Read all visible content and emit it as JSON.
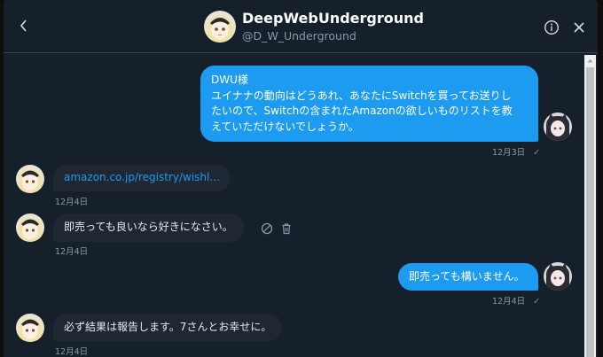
{
  "header": {
    "name": "DeepWebUnderground",
    "handle": "@D_W_Underground",
    "back_icon": "chevron-left-icon",
    "info_icon": "info-icon",
    "close_icon": "close-icon"
  },
  "colors": {
    "background": "#15202b",
    "outgoing_bubble": "#1d9bf0",
    "incoming_bubble": "#1e2732",
    "link": "#1d9bf0",
    "muted": "#8b98a5"
  },
  "messages": [
    {
      "direction": "outgoing",
      "lines": [
        "DWU様",
        "ユイナナの動向はどうあれ、あなたにSwitchを買ってお送りし",
        "たいので、Switchの含まれたAmazonの欲しいものリストを教",
        "えていただけないでしょうか。"
      ],
      "time": "12月3日",
      "status": "✓"
    },
    {
      "direction": "incoming",
      "link": "amazon.co.jp/registry/wishl…",
      "time": "12月4日"
    },
    {
      "direction": "incoming",
      "text": "即売っても良いなら好きになさい。",
      "time": "12月4日",
      "actions": [
        "report-icon",
        "trash-icon"
      ]
    },
    {
      "direction": "outgoing",
      "text": "即売っても構いません。",
      "time": "12月4日",
      "status": "✓"
    },
    {
      "direction": "incoming",
      "text": "必ず結果は報告します。7さんとお幸せに。",
      "time": "12月4日"
    }
  ]
}
